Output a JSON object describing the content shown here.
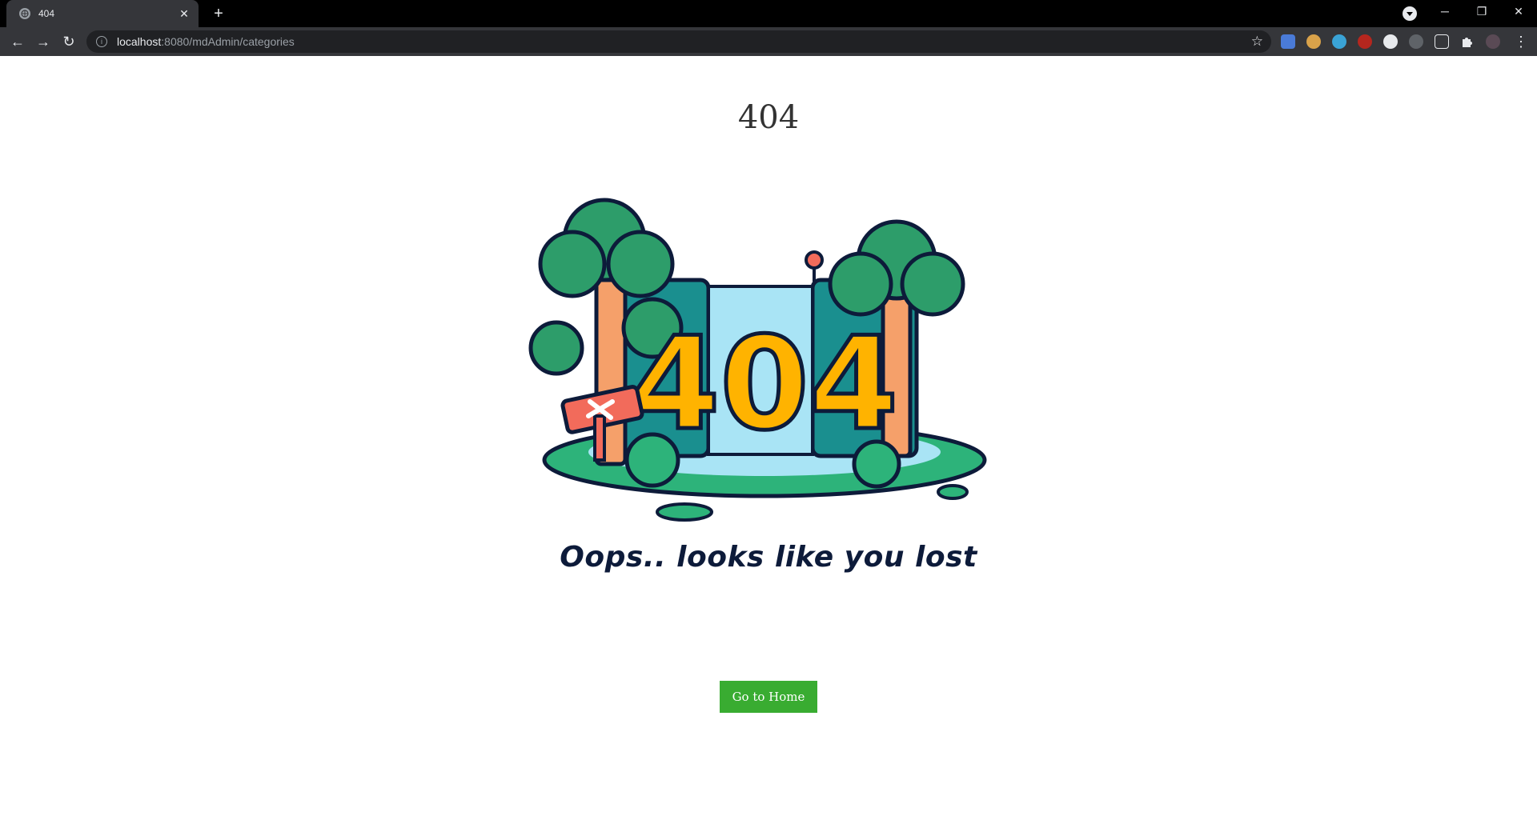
{
  "browser": {
    "tab_title": "404",
    "new_tab_symbol": "+",
    "url_host": "localhost",
    "url_rest": ":8080/mdAdmin/categories",
    "icons": [
      "globe-icon",
      "close-icon",
      "plus-icon",
      "back-icon",
      "forward-icon",
      "reload-icon",
      "info-icon",
      "star-icon",
      "puzzle-icon",
      "menu-icon"
    ]
  },
  "page": {
    "heading": "404",
    "illustration_text": "404",
    "message": "Oops.. looks like you lost",
    "home_button": "Go to Home",
    "colors": {
      "button": "#39ac31",
      "tree": "#2d9d6a",
      "digits": "#ffb300",
      "water": "#a9e4f5"
    }
  }
}
